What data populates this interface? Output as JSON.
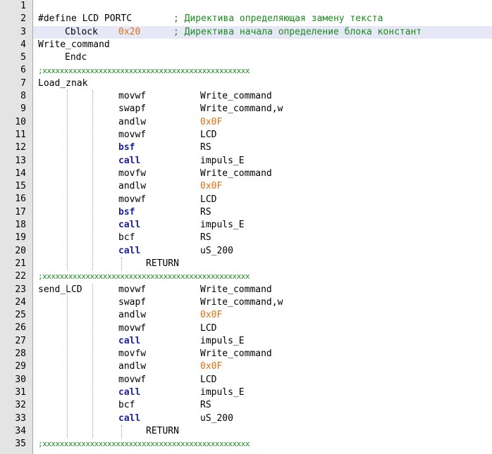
{
  "editor": {
    "lines": [
      {
        "n": "1",
        "tokens": []
      },
      {
        "n": "2",
        "tokens": [
          {
            "t": "#define LCD PORTC",
            "c": "plain",
            "col": "c0"
          },
          {
            "t": "; Директива определяющая замену текста",
            "c": "cmt",
            "col": "c5"
          }
        ]
      },
      {
        "n": "3",
        "highlight": true,
        "tokens": [
          {
            "t": "Cblock",
            "c": "plain",
            "col": "c1"
          },
          {
            "t": "0x20",
            "c": "num",
            "col": "c2"
          },
          {
            "t": "; Директива начала определение блока констант",
            "c": "cmt",
            "col": "c5"
          }
        ]
      },
      {
        "n": "4",
        "tokens": [
          {
            "t": "Write_command",
            "c": "plain",
            "col": "c0"
          }
        ]
      },
      {
        "n": "5",
        "tokens": [
          {
            "t": "Endc",
            "c": "plain",
            "col": "c1"
          }
        ]
      },
      {
        "n": "6",
        "tokens": [
          {
            "t": ";xxxxxxxxxxxxxxxxxxxxxxxxxxxxxxxxxxxxxxxxxxxxxxxx",
            "c": "sep",
            "col": "c0"
          }
        ]
      },
      {
        "n": "7",
        "tokens": [
          {
            "t": "Load_znak",
            "c": "plain",
            "col": "c0"
          }
        ]
      },
      {
        "n": "8",
        "tokens": [
          {
            "t": "movwf",
            "c": "plain",
            "col": "c3"
          },
          {
            "t": "Write_command",
            "c": "plain",
            "col": "c4"
          }
        ]
      },
      {
        "n": "9",
        "tokens": [
          {
            "t": "swapf",
            "c": "plain",
            "col": "c3"
          },
          {
            "t": "Write_command,w",
            "c": "plain",
            "col": "c4"
          }
        ]
      },
      {
        "n": "10",
        "tokens": [
          {
            "t": "andlw",
            "c": "plain",
            "col": "c3"
          },
          {
            "t": "0x0F",
            "c": "num",
            "col": "c4"
          }
        ]
      },
      {
        "n": "11",
        "tokens": [
          {
            "t": "movwf",
            "c": "plain",
            "col": "c3"
          },
          {
            "t": "LCD",
            "c": "plain",
            "col": "c4"
          }
        ]
      },
      {
        "n": "12",
        "tokens": [
          {
            "t": "bsf",
            "c": "kw",
            "col": "c3"
          },
          {
            "t": "RS",
            "c": "plain",
            "col": "c4"
          }
        ]
      },
      {
        "n": "13",
        "tokens": [
          {
            "t": "call",
            "c": "kw",
            "col": "c3"
          },
          {
            "t": "impuls_E",
            "c": "plain",
            "col": "c4"
          }
        ]
      },
      {
        "n": "14",
        "tokens": [
          {
            "t": "movfw",
            "c": "plain",
            "col": "c3"
          },
          {
            "t": "Write_command",
            "c": "plain",
            "col": "c4"
          }
        ]
      },
      {
        "n": "15",
        "tokens": [
          {
            "t": "andlw",
            "c": "plain",
            "col": "c3"
          },
          {
            "t": "0x0F",
            "c": "num",
            "col": "c4"
          }
        ]
      },
      {
        "n": "16",
        "tokens": [
          {
            "t": "movwf",
            "c": "plain",
            "col": "c3"
          },
          {
            "t": "LCD",
            "c": "plain",
            "col": "c4"
          }
        ]
      },
      {
        "n": "17",
        "tokens": [
          {
            "t": "bsf",
            "c": "kw",
            "col": "c3"
          },
          {
            "t": "RS",
            "c": "plain",
            "col": "c4"
          }
        ]
      },
      {
        "n": "18",
        "tokens": [
          {
            "t": "call",
            "c": "kw",
            "col": "c3"
          },
          {
            "t": "impuls_E",
            "c": "plain",
            "col": "c4"
          }
        ]
      },
      {
        "n": "19",
        "tokens": [
          {
            "t": "bcf",
            "c": "plain",
            "col": "c3"
          },
          {
            "t": "RS",
            "c": "plain",
            "col": "c4"
          }
        ]
      },
      {
        "n": "20",
        "tokens": [
          {
            "t": "call",
            "c": "kw",
            "col": "c3"
          },
          {
            "t": "uS_200",
            "c": "plain",
            "col": "c4"
          }
        ]
      },
      {
        "n": "21",
        "tokens": [
          {
            "t": "RETURN",
            "c": "plain",
            "col": "c6"
          }
        ]
      },
      {
        "n": "22",
        "tokens": [
          {
            "t": ";xxxxxxxxxxxxxxxxxxxxxxxxxxxxxxxxxxxxxxxxxxxxxxxx",
            "c": "sep",
            "col": "c0"
          }
        ]
      },
      {
        "n": "23",
        "tokens": [
          {
            "t": "send_LCD",
            "c": "plain",
            "col": "c0"
          },
          {
            "t": "movwf",
            "c": "plain",
            "col": "c3"
          },
          {
            "t": "Write_command",
            "c": "plain",
            "col": "c4"
          }
        ]
      },
      {
        "n": "24",
        "tokens": [
          {
            "t": "swapf",
            "c": "plain",
            "col": "c3"
          },
          {
            "t": "Write_command,w",
            "c": "plain",
            "col": "c4"
          }
        ]
      },
      {
        "n": "25",
        "tokens": [
          {
            "t": "andlw",
            "c": "plain",
            "col": "c3"
          },
          {
            "t": "0x0F",
            "c": "num",
            "col": "c4"
          }
        ]
      },
      {
        "n": "26",
        "tokens": [
          {
            "t": "movwf",
            "c": "plain",
            "col": "c3"
          },
          {
            "t": "LCD",
            "c": "plain",
            "col": "c4"
          }
        ]
      },
      {
        "n": "27",
        "tokens": [
          {
            "t": "call",
            "c": "kw",
            "col": "c3"
          },
          {
            "t": "impuls_E",
            "c": "plain",
            "col": "c4"
          }
        ]
      },
      {
        "n": "28",
        "tokens": [
          {
            "t": "movfw",
            "c": "plain",
            "col": "c3"
          },
          {
            "t": "Write_command",
            "c": "plain",
            "col": "c4"
          }
        ]
      },
      {
        "n": "29",
        "tokens": [
          {
            "t": "andlw",
            "c": "plain",
            "col": "c3"
          },
          {
            "t": "0x0F",
            "c": "num",
            "col": "c4"
          }
        ]
      },
      {
        "n": "30",
        "tokens": [
          {
            "t": "movwf",
            "c": "plain",
            "col": "c3"
          },
          {
            "t": "LCD",
            "c": "plain",
            "col": "c4"
          }
        ]
      },
      {
        "n": "31",
        "tokens": [
          {
            "t": "call",
            "c": "kw",
            "col": "c3"
          },
          {
            "t": "impuls_E",
            "c": "plain",
            "col": "c4"
          }
        ]
      },
      {
        "n": "32",
        "tokens": [
          {
            "t": "bcf",
            "c": "plain",
            "col": "c3"
          },
          {
            "t": "RS",
            "c": "plain",
            "col": "c4"
          }
        ]
      },
      {
        "n": "33",
        "tokens": [
          {
            "t": "call",
            "c": "kw",
            "col": "c3"
          },
          {
            "t": "uS_200",
            "c": "plain",
            "col": "c4"
          }
        ]
      },
      {
        "n": "34",
        "tokens": [
          {
            "t": "RETURN",
            "c": "plain",
            "col": "c6"
          }
        ]
      },
      {
        "n": "35",
        "tokens": [
          {
            "t": ";xxxxxxxxxxxxxxxxxxxxxxxxxxxxxxxxxxxxxxxxxxxxxxxx",
            "c": "sep",
            "col": "c0"
          }
        ]
      }
    ]
  },
  "colors": {
    "keyword": "#1a1fa8",
    "number": "#e07010",
    "comment": "#1c8a1c",
    "gutter": "#e4e4e4",
    "current_line": "#e6e8f8"
  }
}
